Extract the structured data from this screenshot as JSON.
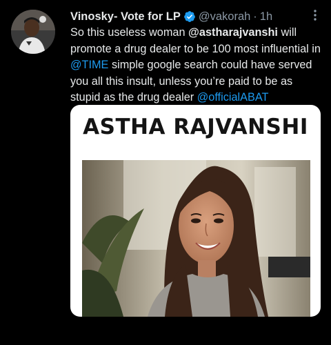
{
  "tweet": {
    "display_name": "Vinosky- Vote for LP",
    "verified_icon": "verified-badge-icon",
    "handle": "@vakorah",
    "separator": "·",
    "time": "1h",
    "more_icon": "more-options-icon",
    "text": {
      "seg1": "So this useless woman ",
      "mention1": "@astharajvanshi",
      "seg2": " will promote a drug dealer to be 100 most influential in ",
      "mention2": "@TIME",
      "seg3": " simple google search could have served you all this insult, unless you’re paid to be as stupid as the drug dealer ",
      "mention3": "@officialABAT"
    },
    "media": {
      "title": "ASTHA RAJVANSHI",
      "photo": "woman-portrait-photo"
    }
  },
  "colors": {
    "background": "#000000",
    "text": "#e7e9ea",
    "secondary_text": "#8b98a5",
    "link": "#1d9bf0",
    "verified": "#1d9bf0"
  }
}
